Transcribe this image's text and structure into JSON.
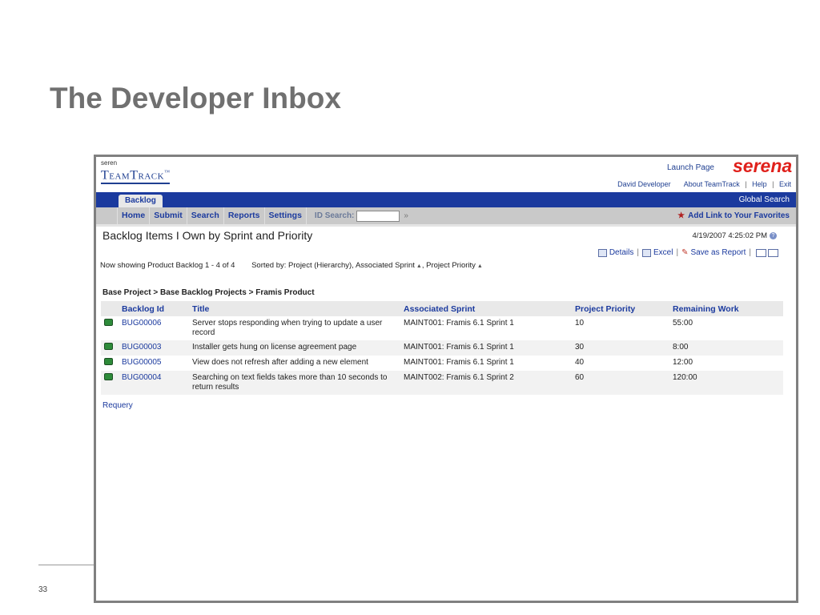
{
  "slide": {
    "title": "The Developer Inbox",
    "page_number": "33"
  },
  "app": {
    "logo_small": "seren",
    "logo_main": "TeamTrack",
    "logo_tm": "™",
    "launch_page": "Launch Page",
    "brand": "serena",
    "user": "David Developer",
    "links": [
      "About TeamTrack",
      "Help",
      "Exit"
    ],
    "tab": "Backlog",
    "global_search": "Global Search",
    "nav": [
      "Home",
      "Submit",
      "Search",
      "Reports",
      "Settings"
    ],
    "id_search_label": "ID Search:",
    "id_search_value": "",
    "go": "»",
    "favorites": "Add Link to Your Favorites",
    "colors": {
      "nav_blue": "#1b3a9e",
      "brand_red": "#e0201b"
    }
  },
  "report": {
    "heading": "Backlog Items I Own by Sprint and Priority",
    "datetime": "4/19/2007 4:25:02 PM",
    "actions": {
      "details": "Details",
      "excel": "Excel",
      "save_report": "Save as Report"
    },
    "showing": "Now showing Product Backlog 1 - 4 of 4",
    "sorted_by": "Sorted by: Project (Hierarchy), Associated Sprint",
    "sorted_by_2": ", Project Priority",
    "breadcrumb": "Base Project > Base Backlog Projects > Framis Product",
    "columns": [
      "Backlog Id",
      "Title",
      "Associated Sprint",
      "Project Priority",
      "Remaining Work"
    ],
    "rows": [
      {
        "id": "BUG00006",
        "title": "Server stops responding when trying to update a user record",
        "sprint": "MAINT001: Framis 6.1 Sprint 1",
        "priority": "10",
        "remaining": "55:00"
      },
      {
        "id": "BUG00003",
        "title": "Installer gets hung on license agreement page",
        "sprint": "MAINT001: Framis 6.1 Sprint 1",
        "priority": "30",
        "remaining": "8:00"
      },
      {
        "id": "BUG00005",
        "title": "View does not refresh after adding a new element",
        "sprint": "MAINT001: Framis 6.1 Sprint 1",
        "priority": "40",
        "remaining": "12:00"
      },
      {
        "id": "BUG00004",
        "title": "Searching on text fields takes more than 10 seconds to return results",
        "sprint": "MAINT002: Framis 6.1 Sprint 2",
        "priority": "60",
        "remaining": "120:00"
      }
    ],
    "requery": "Requery"
  }
}
